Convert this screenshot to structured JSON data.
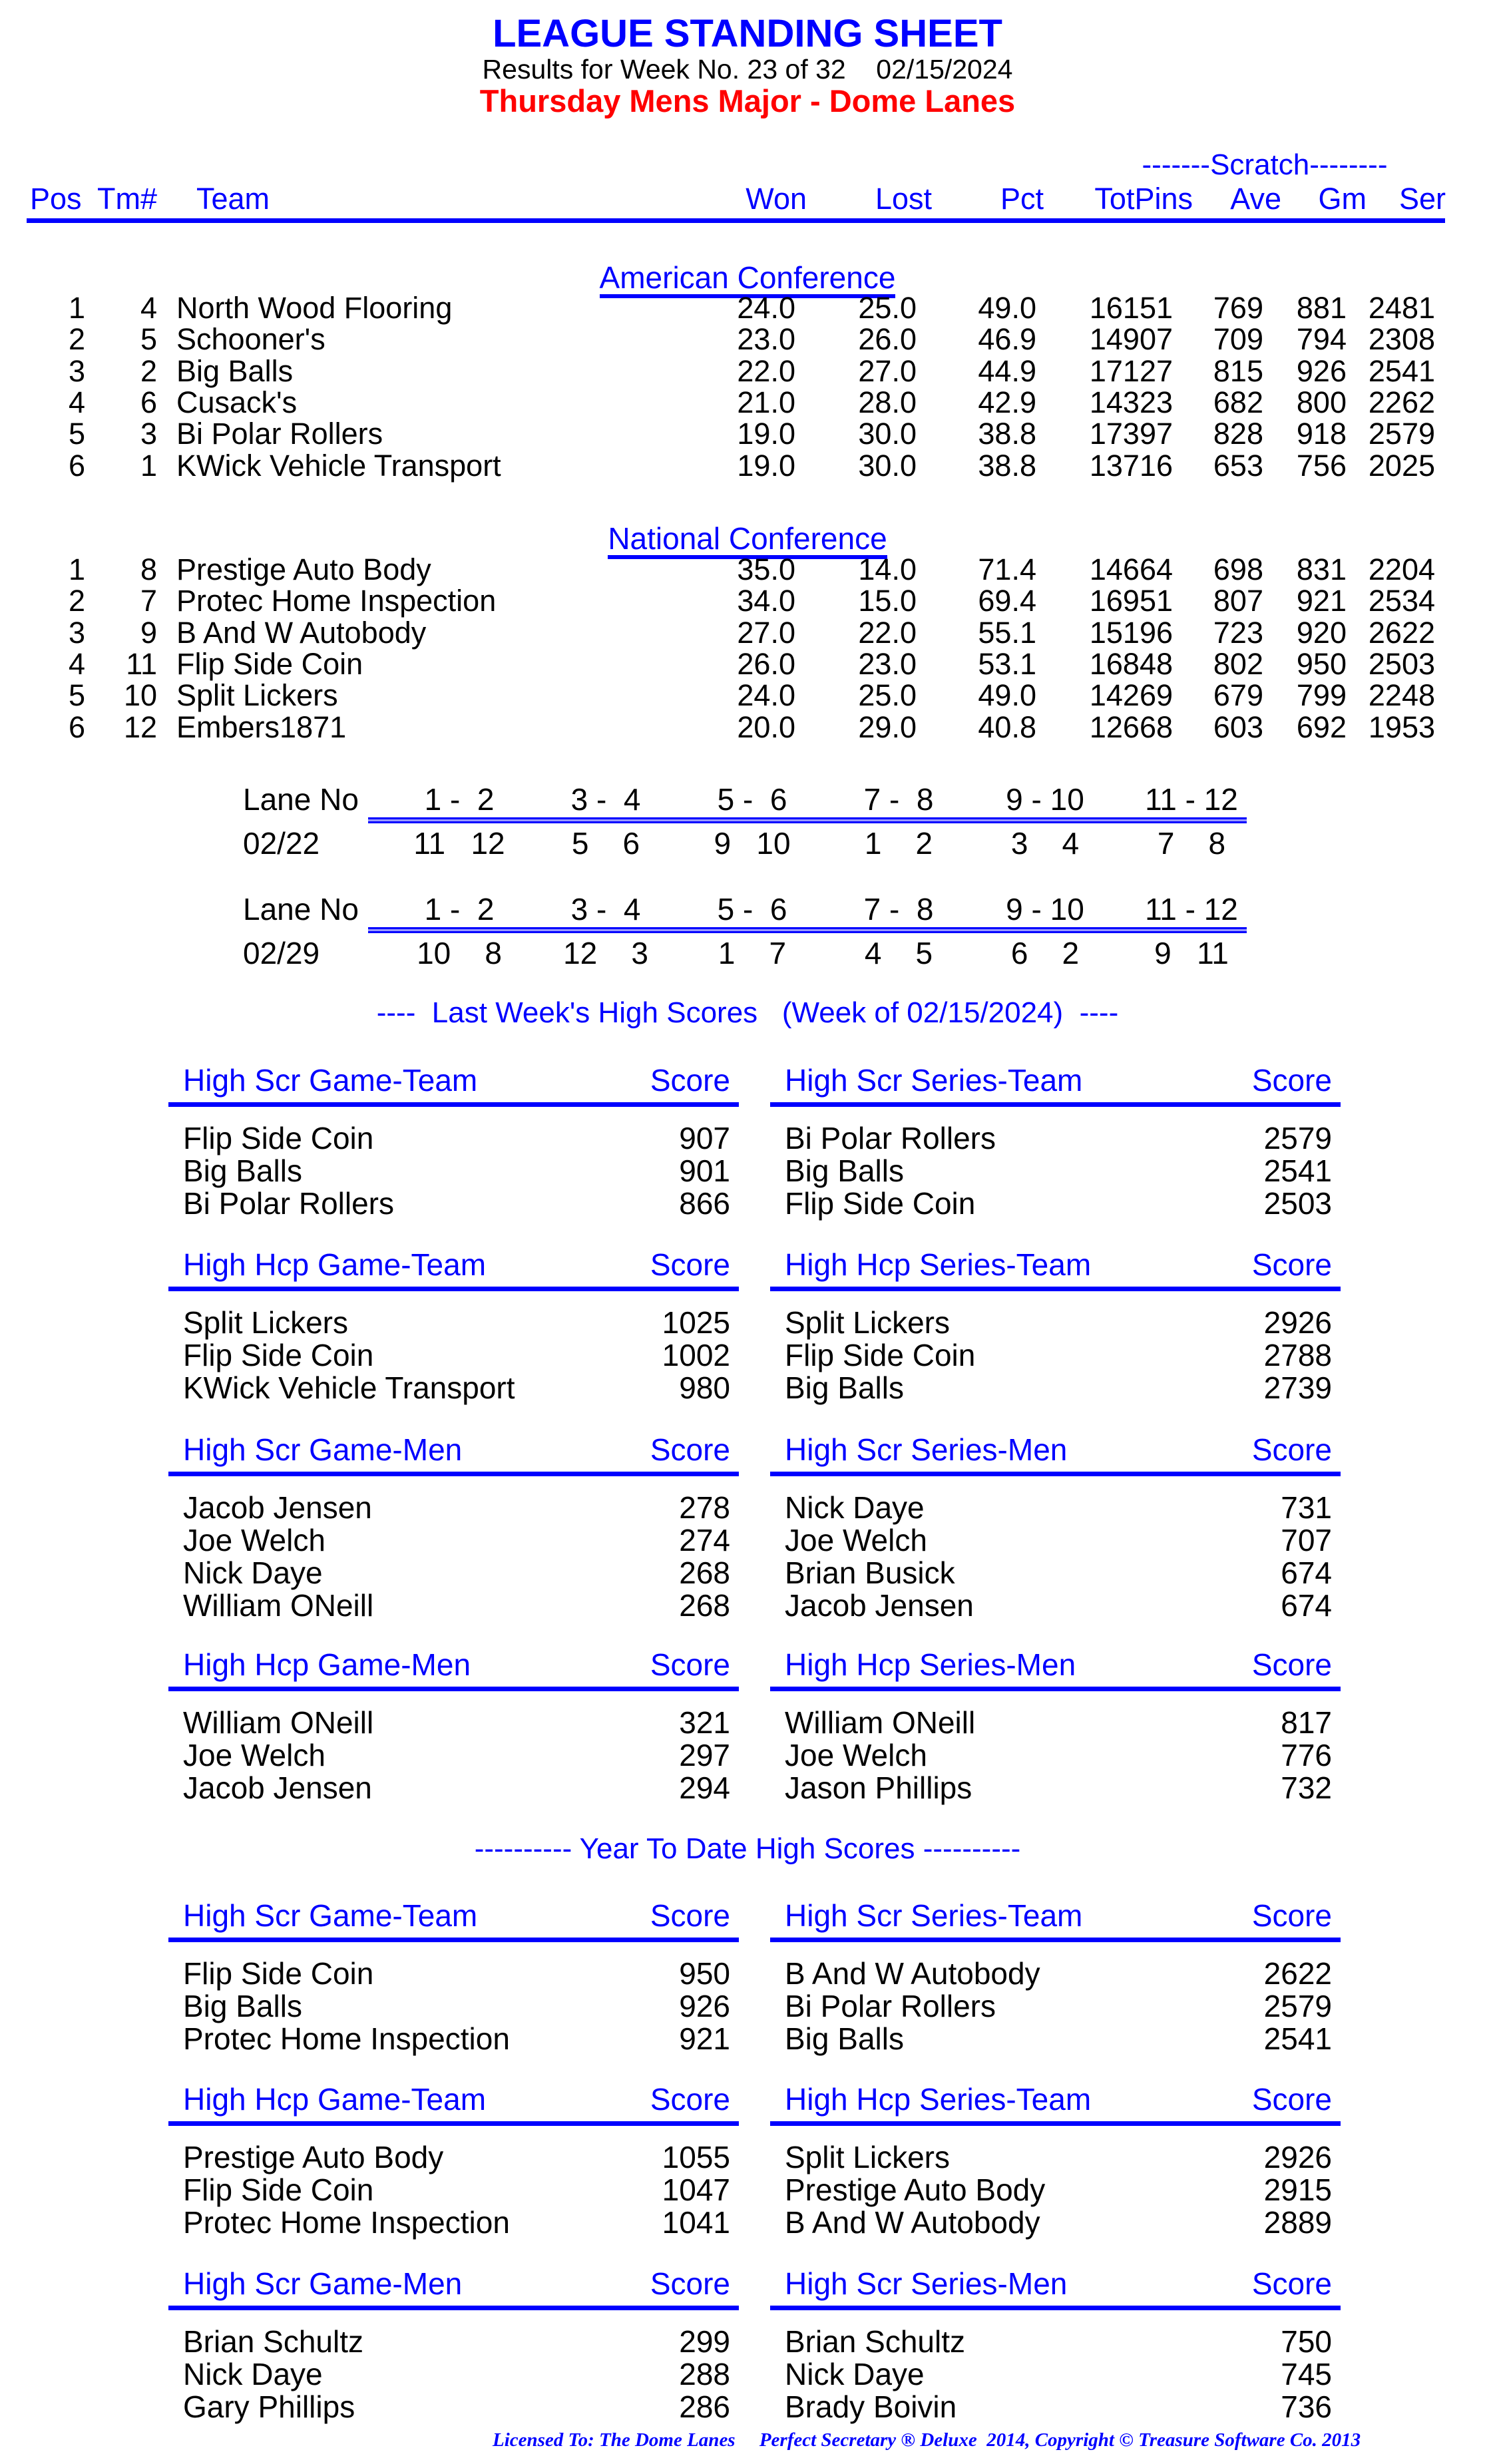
{
  "header": {
    "title": "LEAGUE STANDING SHEET",
    "subtitle": "Results for Week No. 23 of 32    02/15/2024",
    "league": "Thursday Mens Major - Dome Lanes"
  },
  "standings": {
    "scratch_label": "-------Scratch--------",
    "columns": [
      "Pos",
      "Tm#",
      "Team",
      "Won",
      "Lost",
      "Pct",
      "TotPins",
      "Ave",
      "Gm",
      "Ser"
    ],
    "conferences": [
      {
        "name": "American Conference",
        "rows": [
          {
            "pos": "1",
            "tm": "4",
            "team": "North Wood Flooring",
            "won": "24.0",
            "lost": "25.0",
            "pct": "49.0",
            "totpins": "16151",
            "ave": "769",
            "gm": "881",
            "ser": "2481"
          },
          {
            "pos": "2",
            "tm": "5",
            "team": "Schooner's",
            "won": "23.0",
            "lost": "26.0",
            "pct": "46.9",
            "totpins": "14907",
            "ave": "709",
            "gm": "794",
            "ser": "2308"
          },
          {
            "pos": "3",
            "tm": "2",
            "team": "Big Balls",
            "won": "22.0",
            "lost": "27.0",
            "pct": "44.9",
            "totpins": "17127",
            "ave": "815",
            "gm": "926",
            "ser": "2541"
          },
          {
            "pos": "4",
            "tm": "6",
            "team": "Cusack's",
            "won": "21.0",
            "lost": "28.0",
            "pct": "42.9",
            "totpins": "14323",
            "ave": "682",
            "gm": "800",
            "ser": "2262"
          },
          {
            "pos": "5",
            "tm": "3",
            "team": "Bi Polar Rollers",
            "won": "19.0",
            "lost": "30.0",
            "pct": "38.8",
            "totpins": "17397",
            "ave": "828",
            "gm": "918",
            "ser": "2579"
          },
          {
            "pos": "6",
            "tm": "1",
            "team": "KWick Vehicle Transport",
            "won": "19.0",
            "lost": "30.0",
            "pct": "38.8",
            "totpins": "13716",
            "ave": "653",
            "gm": "756",
            "ser": "2025"
          }
        ]
      },
      {
        "name": "National Conference",
        "rows": [
          {
            "pos": "1",
            "tm": "8",
            "team": "Prestige Auto Body",
            "won": "35.0",
            "lost": "14.0",
            "pct": "71.4",
            "totpins": "14664",
            "ave": "698",
            "gm": "831",
            "ser": "2204"
          },
          {
            "pos": "2",
            "tm": "7",
            "team": "Protec Home Inspection",
            "won": "34.0",
            "lost": "15.0",
            "pct": "69.4",
            "totpins": "16951",
            "ave": "807",
            "gm": "921",
            "ser": "2534"
          },
          {
            "pos": "3",
            "tm": "9",
            "team": "B And W Autobody",
            "won": "27.0",
            "lost": "22.0",
            "pct": "55.1",
            "totpins": "15196",
            "ave": "723",
            "gm": "920",
            "ser": "2622"
          },
          {
            "pos": "4",
            "tm": "11",
            "team": "Flip Side Coin",
            "won": "26.0",
            "lost": "23.0",
            "pct": "53.1",
            "totpins": "16848",
            "ave": "802",
            "gm": "950",
            "ser": "2503"
          },
          {
            "pos": "5",
            "tm": "10",
            "team": "Split Lickers",
            "won": "24.0",
            "lost": "25.0",
            "pct": "49.0",
            "totpins": "14269",
            "ave": "679",
            "gm": "799",
            "ser": "2248"
          },
          {
            "pos": "6",
            "tm": "12",
            "team": "Embers1871",
            "won": "20.0",
            "lost": "29.0",
            "pct": "40.8",
            "totpins": "12668",
            "ave": "603",
            "gm": "692",
            "ser": "1953"
          }
        ]
      }
    ]
  },
  "lanes": {
    "label": "Lane No",
    "pairs": [
      "1 -  2",
      "3 -  4",
      "5 -  6",
      "7 -  8",
      "9 - 10",
      "11 - 12"
    ],
    "schedule": [
      {
        "date": "02/22",
        "matchups": [
          "11   12",
          "5    6",
          "9   10",
          "1    2",
          "3    4",
          "7    8"
        ]
      },
      {
        "date": "02/29",
        "matchups": [
          "10    8",
          "12    3",
          "1    7",
          "4    5",
          "6    2",
          "9   11"
        ]
      }
    ]
  },
  "last_week": {
    "heading": "----  Last Week's High Scores   (Week of 02/15/2024)  ----",
    "score_label": "Score",
    "blocks": [
      {
        "title": "High Scr Game-Team",
        "rows": [
          [
            "Flip Side Coin",
            "907"
          ],
          [
            "Big Balls",
            "901"
          ],
          [
            "Bi Polar Rollers",
            "866"
          ]
        ]
      },
      {
        "title": "High Scr Series-Team",
        "rows": [
          [
            "Bi Polar Rollers",
            "2579"
          ],
          [
            "Big Balls",
            "2541"
          ],
          [
            "Flip Side Coin",
            "2503"
          ]
        ]
      },
      {
        "title": "High Hcp Game-Team",
        "rows": [
          [
            "Split Lickers",
            "1025"
          ],
          [
            "Flip Side Coin",
            "1002"
          ],
          [
            "KWick Vehicle Transport",
            "980"
          ]
        ]
      },
      {
        "title": "High Hcp Series-Team",
        "rows": [
          [
            "Split Lickers",
            "2926"
          ],
          [
            "Flip Side Coin",
            "2788"
          ],
          [
            "Big Balls",
            "2739"
          ]
        ]
      },
      {
        "title": "High Scr Game-Men",
        "rows": [
          [
            "Jacob Jensen",
            "278"
          ],
          [
            "Joe Welch",
            "274"
          ],
          [
            "Nick Daye",
            "268"
          ],
          [
            "William ONeill",
            "268"
          ]
        ]
      },
      {
        "title": "High Scr Series-Men",
        "rows": [
          [
            "Nick Daye",
            "731"
          ],
          [
            "Joe Welch",
            "707"
          ],
          [
            "Brian Busick",
            "674"
          ],
          [
            "Jacob Jensen",
            "674"
          ]
        ]
      },
      {
        "title": "High Hcp Game-Men",
        "rows": [
          [
            "William ONeill",
            "321"
          ],
          [
            "Joe Welch",
            "297"
          ],
          [
            "Jacob Jensen",
            "294"
          ]
        ]
      },
      {
        "title": "High Hcp Series-Men",
        "rows": [
          [
            "William ONeill",
            "817"
          ],
          [
            "Joe Welch",
            "776"
          ],
          [
            "Jason Phillips",
            "732"
          ]
        ]
      }
    ]
  },
  "year_to_date": {
    "heading": "---------- Year To Date High Scores ----------",
    "score_label": "Score",
    "blocks": [
      {
        "title": "High Scr Game-Team",
        "rows": [
          [
            "Flip Side Coin",
            "950"
          ],
          [
            "Big Balls",
            "926"
          ],
          [
            "Protec Home Inspection",
            "921"
          ]
        ]
      },
      {
        "title": "High Scr Series-Team",
        "rows": [
          [
            "B And W Autobody",
            "2622"
          ],
          [
            "Bi Polar Rollers",
            "2579"
          ],
          [
            "Big Balls",
            "2541"
          ]
        ]
      },
      {
        "title": "High Hcp Game-Team",
        "rows": [
          [
            "Prestige Auto Body",
            "1055"
          ],
          [
            "Flip Side Coin",
            "1047"
          ],
          [
            "Protec Home Inspection",
            "1041"
          ]
        ]
      },
      {
        "title": "High Hcp Series-Team",
        "rows": [
          [
            "Split Lickers",
            "2926"
          ],
          [
            "Prestige Auto Body",
            "2915"
          ],
          [
            "B And W Autobody",
            "2889"
          ]
        ]
      },
      {
        "title": "High Scr Game-Men",
        "rows": [
          [
            "Brian Schultz",
            "299"
          ],
          [
            "Nick Daye",
            "288"
          ],
          [
            "Gary Phillips",
            "286"
          ]
        ]
      },
      {
        "title": "High Scr Series-Men",
        "rows": [
          [
            "Brian Schultz",
            "750"
          ],
          [
            "Nick Daye",
            "745"
          ],
          [
            "Brady Boivin",
            "736"
          ]
        ]
      }
    ]
  },
  "footer": {
    "text": "Licensed To: The Dome Lanes     Perfect Secretary ® Deluxe  2014, Copyright © Treasure Software Co. 2013"
  },
  "colors": {
    "heading_blue": "#0000ff",
    "league_red": "#ff0000",
    "body_text": "#000000"
  }
}
